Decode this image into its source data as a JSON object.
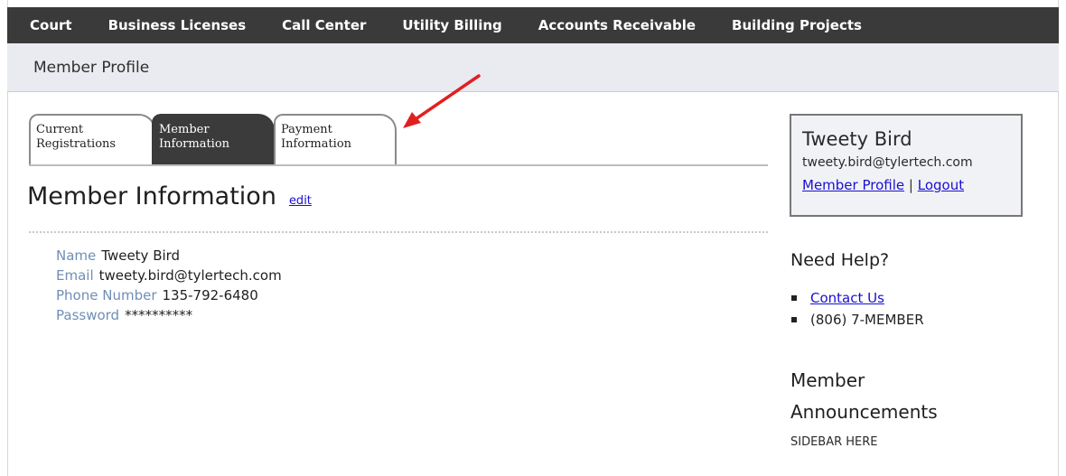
{
  "nav": {
    "items": [
      {
        "label": "Court"
      },
      {
        "label": "Business Licenses"
      },
      {
        "label": "Call Center"
      },
      {
        "label": "Utility Billing"
      },
      {
        "label": "Accounts Receivable"
      },
      {
        "label": "Building Projects"
      }
    ]
  },
  "header": {
    "title": "Member Profile"
  },
  "tabs": [
    {
      "line1": "Current",
      "line2": "Registrations",
      "active": false
    },
    {
      "line1": "Member",
      "line2": "Information",
      "active": true
    },
    {
      "line1": "Payment",
      "line2": "Information",
      "active": false
    }
  ],
  "main": {
    "heading": "Member Information",
    "edit_label": "edit",
    "fields": [
      {
        "label": "Name",
        "value": "Tweety Bird"
      },
      {
        "label": "Email",
        "value": "tweety.bird@tylertech.com"
      },
      {
        "label": "Phone Number",
        "value": "135-792-6480"
      },
      {
        "label": "Password",
        "value": "**********"
      }
    ]
  },
  "sidebar": {
    "user_name": "Tweety Bird",
    "user_email": "tweety.bird@tylertech.com",
    "profile_link": "Member Profile",
    "separator": "|",
    "logout_link": "Logout",
    "help_title": "Need Help?",
    "help_items": [
      {
        "text": "Contact Us",
        "is_link": true
      },
      {
        "text": "(806) 7-MEMBER",
        "is_link": false
      }
    ],
    "announcements_title_line1": "Member",
    "announcements_title_line2": "Announcements",
    "announcements_body": "SIDEBAR HERE"
  },
  "colors": {
    "nav_bg": "#3a3a3a",
    "subheader_bg": "#e9ebf1",
    "label_blue": "#6f8fb5",
    "link_blue": "#1a0fd0",
    "arrow_red": "#e02020"
  },
  "annotation": {
    "icon": "red-arrow-icon"
  }
}
